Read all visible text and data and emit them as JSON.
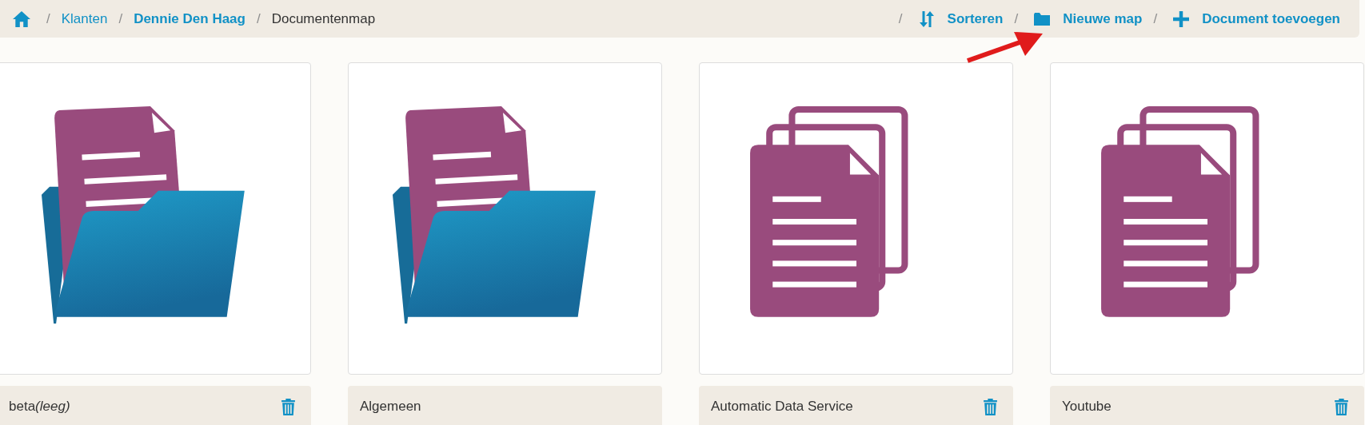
{
  "breadcrumb": [
    {
      "separator": "/",
      "label": "Klanten",
      "bold": false,
      "link": true
    },
    {
      "separator": "/",
      "label": "Dennie Den Haag",
      "bold": true,
      "link": true
    },
    {
      "separator": "/",
      "label": "Documentenmap",
      "bold": false,
      "link": false
    }
  ],
  "actions": [
    {
      "separator": "/",
      "kind": "sort",
      "label": "Sorteren"
    },
    {
      "separator": "/",
      "kind": "folder",
      "label": "Nieuwe map"
    },
    {
      "separator": "/",
      "kind": "add",
      "label": "Document toevoegen"
    }
  ],
  "items": [
    {
      "kind": "folder",
      "name": "beta",
      "note": "(leeg)",
      "deletable": true
    },
    {
      "kind": "folder",
      "name": "Algemeen",
      "deletable": false
    },
    {
      "kind": "documents",
      "name": "Automatic Data Service",
      "deletable": true
    },
    {
      "kind": "documents",
      "name": "Youtube",
      "deletable": true
    }
  ]
}
